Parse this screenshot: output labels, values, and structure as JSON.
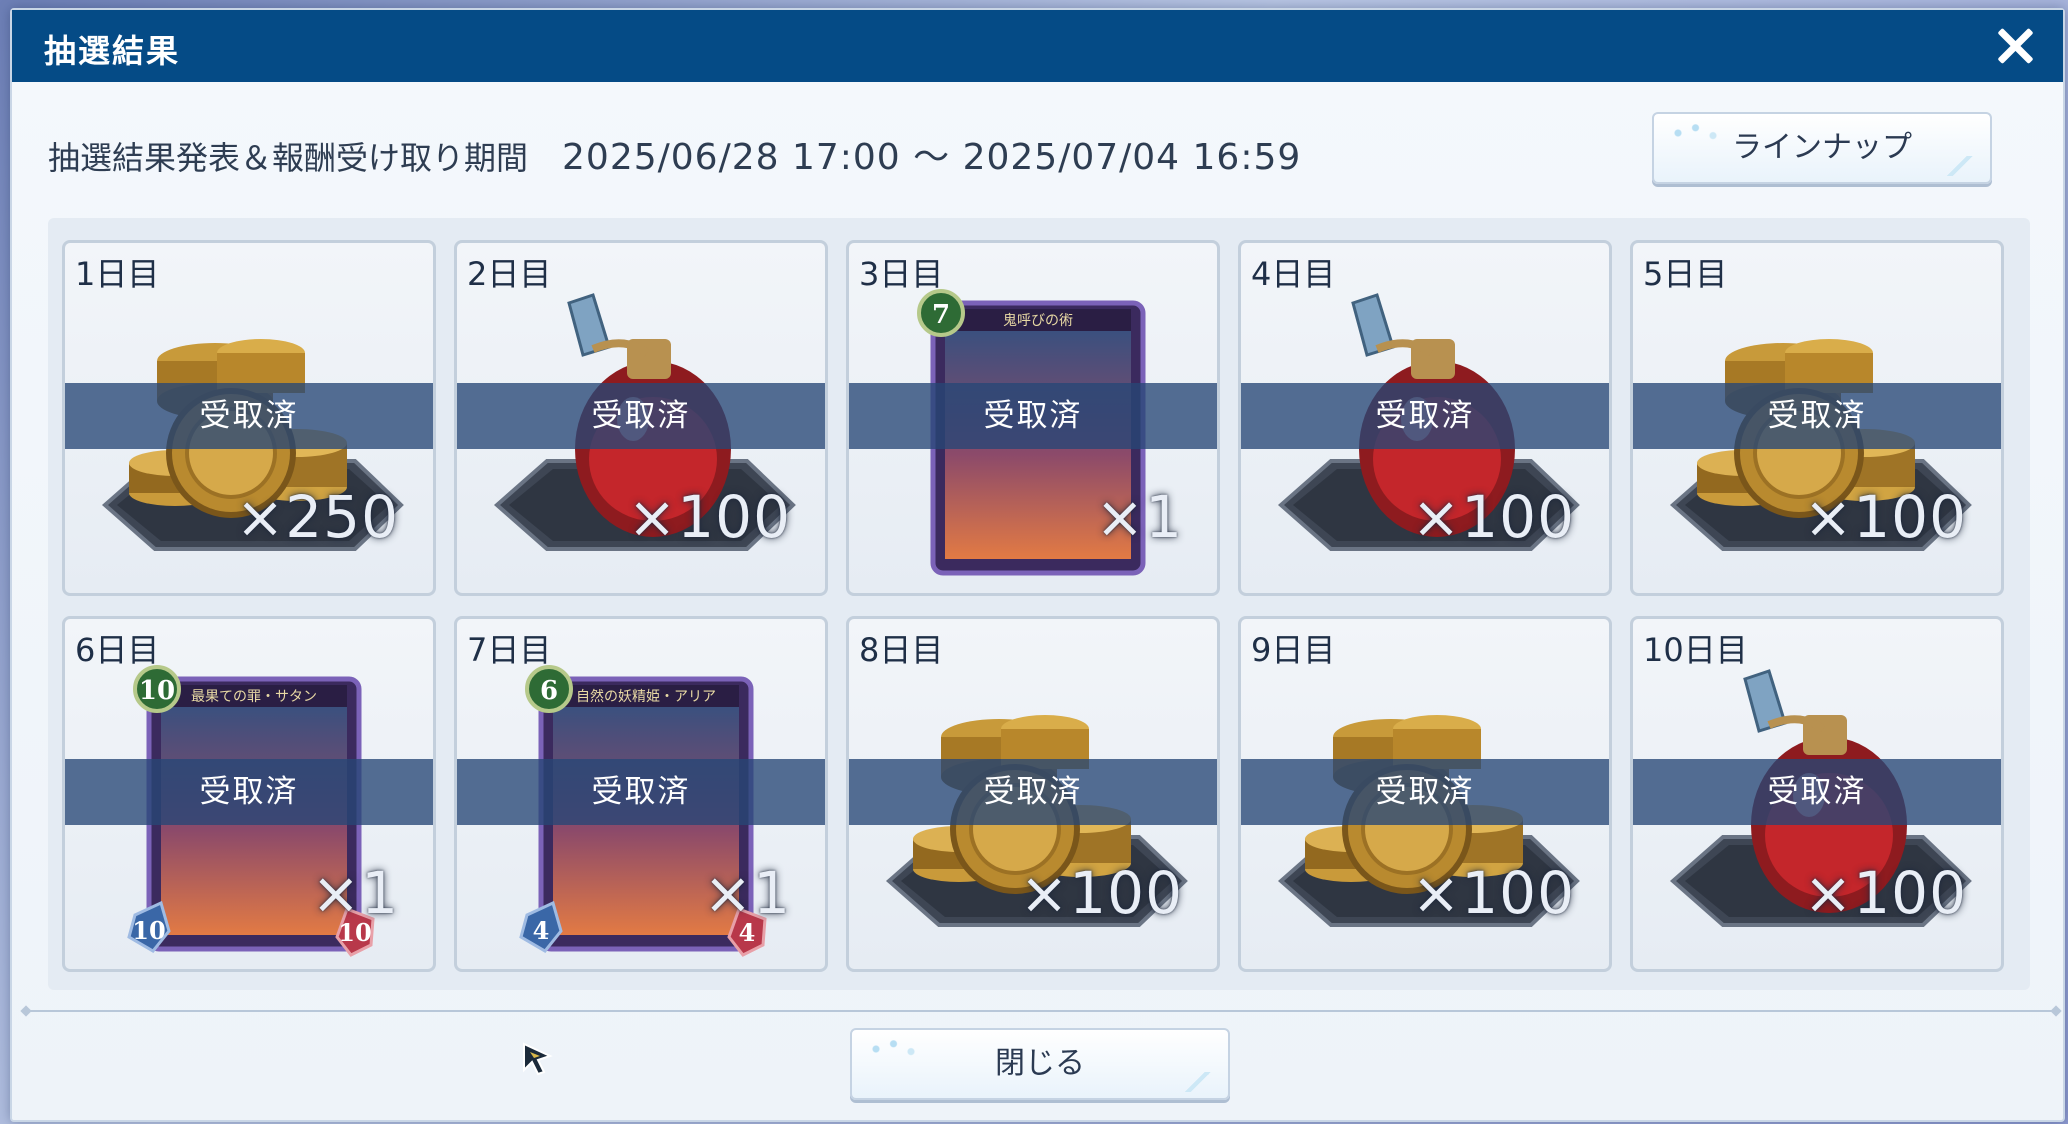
{
  "dialog": {
    "title": "抽選結果",
    "close_icon": "close-icon"
  },
  "period": {
    "label": "抽選結果発表＆報酬受け取り期間",
    "dates": "2025/06/28 17:00 ～ 2025/07/04 16:59"
  },
  "buttons": {
    "lineup": "ラインナップ",
    "close": "閉じる"
  },
  "status_text": "受取済",
  "days": [
    {
      "label": "1日目",
      "item": "coins-icon",
      "quantity": "×250",
      "status": "受取済"
    },
    {
      "label": "2日目",
      "item": "potion-icon",
      "quantity": "×100",
      "status": "受取済"
    },
    {
      "label": "3日目",
      "item": "card-icon",
      "card_cost": "7",
      "card_name": "鬼呼びの術",
      "quantity": "×1",
      "status": "受取済"
    },
    {
      "label": "4日目",
      "item": "potion-icon",
      "quantity": "×100",
      "status": "受取済"
    },
    {
      "label": "5日目",
      "item": "coins-icon",
      "quantity": "×100",
      "status": "受取済"
    },
    {
      "label": "6日目",
      "item": "card-icon",
      "card_cost": "10",
      "card_name": "最果ての罪・サタン",
      "card_atk": "10",
      "card_def": "10",
      "quantity": "×1",
      "status": "受取済"
    },
    {
      "label": "7日目",
      "item": "card-icon",
      "card_cost": "6",
      "card_name": "自然の妖精姫・アリア",
      "card_atk": "4",
      "card_def": "4",
      "quantity": "×1",
      "status": "受取済"
    },
    {
      "label": "8日目",
      "item": "coins-icon",
      "quantity": "×100",
      "status": "受取済"
    },
    {
      "label": "9日目",
      "item": "coins-icon",
      "quantity": "×100",
      "status": "受取済"
    },
    {
      "label": "10日目",
      "item": "potion-icon",
      "quantity": "×100",
      "status": "受取済"
    }
  ],
  "colors": {
    "title_bar": "#054b86",
    "band": "#264676",
    "card_border": "#c3cfdc"
  }
}
